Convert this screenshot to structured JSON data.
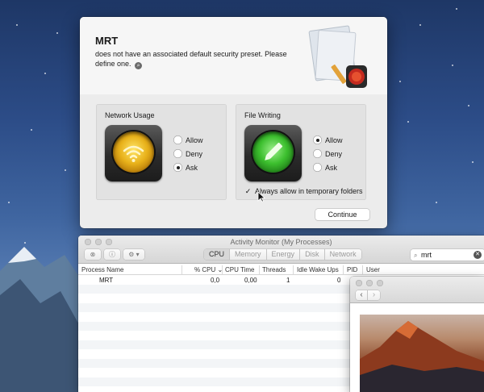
{
  "dialog": {
    "title": "MRT",
    "message": "does not have an associated default security preset. Please define one.",
    "network_panel": {
      "title": "Network Usage",
      "options": [
        "Allow",
        "Deny",
        "Ask"
      ],
      "selected": "Ask"
    },
    "file_panel": {
      "title": "File Writing",
      "options": [
        "Allow",
        "Deny",
        "Ask"
      ],
      "selected": "Allow",
      "checkbox_label": "Always allow in temporary folders",
      "checkbox_checked": true
    },
    "continue_label": "Continue"
  },
  "activity_monitor": {
    "title": "Activity Monitor (My Processes)",
    "tabs": [
      "CPU",
      "Memory",
      "Energy",
      "Disk",
      "Network"
    ],
    "active_tab": "CPU",
    "search_value": "mrt",
    "columns": [
      "Process Name",
      "% CPU",
      "CPU Time",
      "Threads",
      "Idle Wake Ups",
      "PID",
      "User"
    ],
    "rows": [
      {
        "name": "MRT",
        "cpu": "0,0",
        "cpu_time": "0,00",
        "threads": "1",
        "idle_wake_ups": "0",
        "pid": "",
        "user": ""
      }
    ]
  },
  "icons": {
    "network": "wifi-icon",
    "file": "pencil-icon",
    "search": "magnifier-icon"
  },
  "colors": {
    "network_light": "#e8b11a",
    "file_light": "#3cbf2e"
  }
}
